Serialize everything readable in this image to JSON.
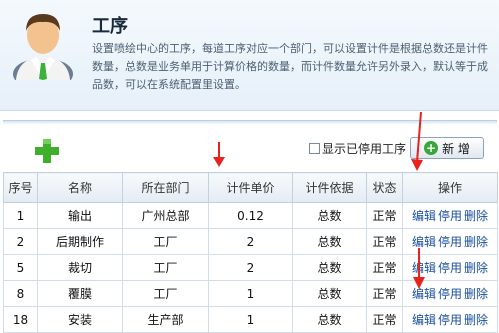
{
  "page": {
    "title": "工序",
    "description": "设置喷绘中心的工序，每道工序对应一个部门，可以设置计件是根据总数还是计件数量，总数是业务单用于计算价格的数量，而计件数量允许另外录入，默认等于成品数，可以在系统配置里设置。"
  },
  "toolbar": {
    "show_disabled_label": "显示已停用工序",
    "new_label": "新 增"
  },
  "table": {
    "headers": [
      "序号",
      "名称",
      "所在部门",
      "计件单价",
      "计件依据",
      "状态",
      "操作"
    ],
    "rows": [
      {
        "id": "1",
        "name": "输出",
        "dept": "广州总部",
        "price": "0.12",
        "basis": "总数",
        "status": "正常"
      },
      {
        "id": "2",
        "name": "后期制作",
        "dept": "工厂",
        "price": "2",
        "basis": "总数",
        "status": "正常"
      },
      {
        "id": "5",
        "name": "裁切",
        "dept": "工厂",
        "price": "2",
        "basis": "总数",
        "status": "正常"
      },
      {
        "id": "8",
        "name": "覆膜",
        "dept": "工厂",
        "price": "1",
        "basis": "总数",
        "status": "正常"
      },
      {
        "id": "18",
        "name": "安装",
        "dept": "生产部",
        "price": "1",
        "basis": "总数",
        "status": "正常"
      }
    ],
    "actions": {
      "edit": "编辑",
      "disable": "停用",
      "delete": "删除"
    }
  },
  "colors": {
    "annotation_arrow": "#e8231f",
    "add_icon": "#3fae2a",
    "link": "#1a4fa0"
  },
  "icons": {
    "avatar": "user-avatar-icon",
    "add": "green-plus-icon",
    "new": "add-circle-icon",
    "arrow": "red-arrow-icon"
  }
}
